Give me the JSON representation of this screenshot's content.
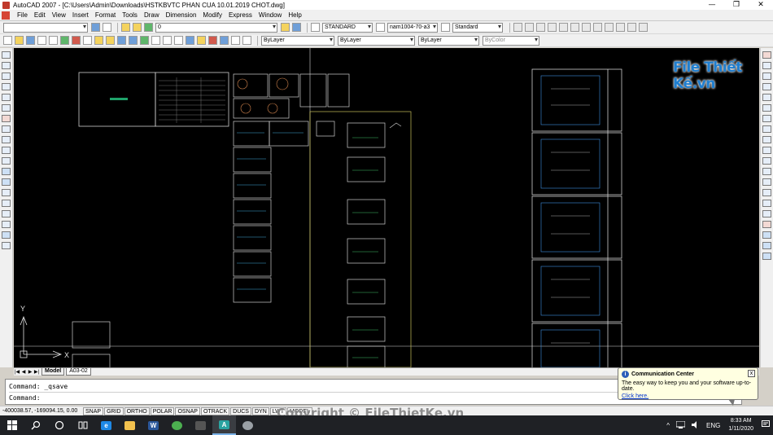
{
  "window": {
    "title": "AutoCAD 2007 - [C:\\Users\\Admin\\Downloads\\HSTKBVTC PHAN CUA 10.01.2019 CHOT.dwg]",
    "minimize": "—",
    "restore": "❐",
    "close": "✕"
  },
  "menu": [
    "File",
    "Edit",
    "View",
    "Insert",
    "Format",
    "Tools",
    "Draw",
    "Dimension",
    "Modify",
    "Express",
    "Window",
    "Help"
  ],
  "toolbar": {
    "layer_value": "0",
    "text_style": "STANDARD",
    "dim_style": "nam1004-70-a3",
    "table_style": "Standard",
    "color": "ByLayer",
    "linetype": "ByLayer",
    "lineweight": "ByLayer",
    "plot_style": "ByColor"
  },
  "watermark_logo": "File Thiết Kế.vn",
  "axis": {
    "y": "Y",
    "x": "X"
  },
  "tabs": {
    "nav": [
      "|◀",
      "◀",
      "▶",
      "▶|"
    ],
    "items": [
      "Model",
      "A03-02"
    ],
    "active": "Model"
  },
  "command": {
    "history": "Command: _qsave",
    "prompt": "Command:"
  },
  "status": {
    "coords": "-400038.57, -169094.15, 0.00",
    "buttons": [
      "SNAP",
      "GRID",
      "ORTHO",
      "POLAR",
      "OSNAP",
      "OTRACK",
      "DUCS",
      "DYN",
      "LWT",
      "MODEL"
    ]
  },
  "copyright": "Copyright © FileThietKe.vn",
  "communication_center": {
    "title": "Communication Center",
    "message": "The easy way to keep you and your software up-to-date.",
    "link": "Click here.",
    "close": "x"
  },
  "taskbar": {
    "tray": [
      "^",
      "ENG"
    ],
    "time": "8:33 AM",
    "date": "1/11/2020"
  }
}
